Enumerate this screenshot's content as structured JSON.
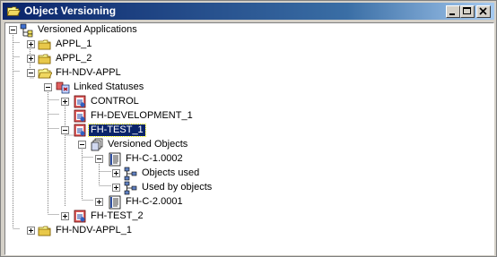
{
  "window": {
    "title": "Object Versioning",
    "accent": "#0a246a"
  },
  "title_buttons": [
    "minimize-icon",
    "maximize-icon",
    "close-icon"
  ],
  "tree": {
    "root": "Versioned Applications",
    "appl_1": "APPL_1",
    "appl_2": "APPL_2",
    "fh_ndv_appl": "FH-NDV-APPL",
    "linked_statuses": "Linked Statuses",
    "control": "CONTROL",
    "fh_development_1": "FH-DEVELOPMENT_1",
    "fh_test_1": "FH-TEST_1",
    "versioned_objects": "Versioned Objects",
    "fh_c_1": "FH-C-1.0002",
    "objects_used": "Objects used",
    "used_by_objects": "Used by objects",
    "fh_c_2": "FH-C-2.0001",
    "fh_test_2": "FH-TEST_2",
    "fh_ndv_appl_1": "FH-NDV-APPL_1"
  },
  "selected": "FH-TEST_1"
}
